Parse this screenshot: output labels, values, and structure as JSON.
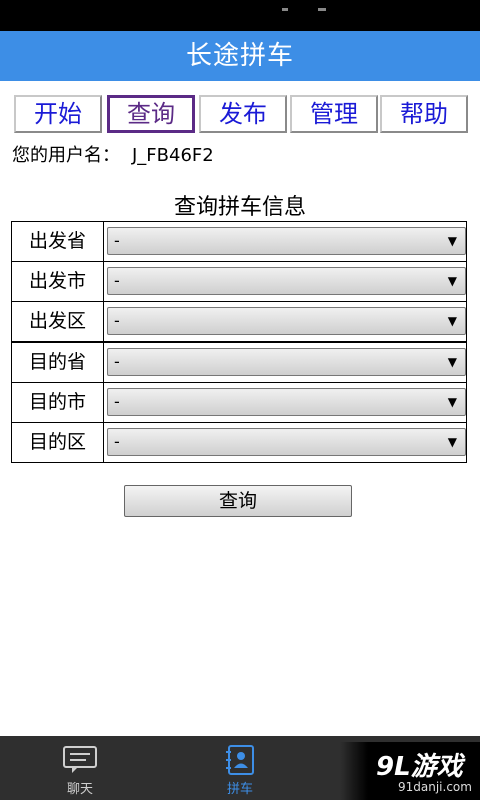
{
  "app": {
    "title": "长途拼车"
  },
  "tabs": [
    {
      "label": "开始"
    },
    {
      "label": "查询"
    },
    {
      "label": "发布"
    },
    {
      "label": "管理"
    },
    {
      "label": "帮助"
    }
  ],
  "active_tab": "查询",
  "user": {
    "label": "您的用户名：",
    "value": "J_FB46F2"
  },
  "form": {
    "title": "查询拼车信息",
    "fields": [
      {
        "label": "出发省",
        "value": "-"
      },
      {
        "label": "出发市",
        "value": "-"
      },
      {
        "label": "出发区",
        "value": "-"
      },
      {
        "label": "目的省",
        "value": "-"
      },
      {
        "label": "目的市",
        "value": "-"
      },
      {
        "label": "目的区",
        "value": "-"
      }
    ],
    "submit_label": "查询"
  },
  "bottom_nav": [
    {
      "label": "聊天",
      "icon": "chat-icon"
    },
    {
      "label": "拼车",
      "icon": "contact-book-icon",
      "active": true
    }
  ],
  "watermark": {
    "main": "9L游戏",
    "sub": "91danji.com"
  },
  "colors": {
    "accent": "#3d8ee6",
    "tab_text": "#1a1ad6",
    "tab_active": "#5b2a86",
    "bottom_bar": "#2f2f2f"
  }
}
